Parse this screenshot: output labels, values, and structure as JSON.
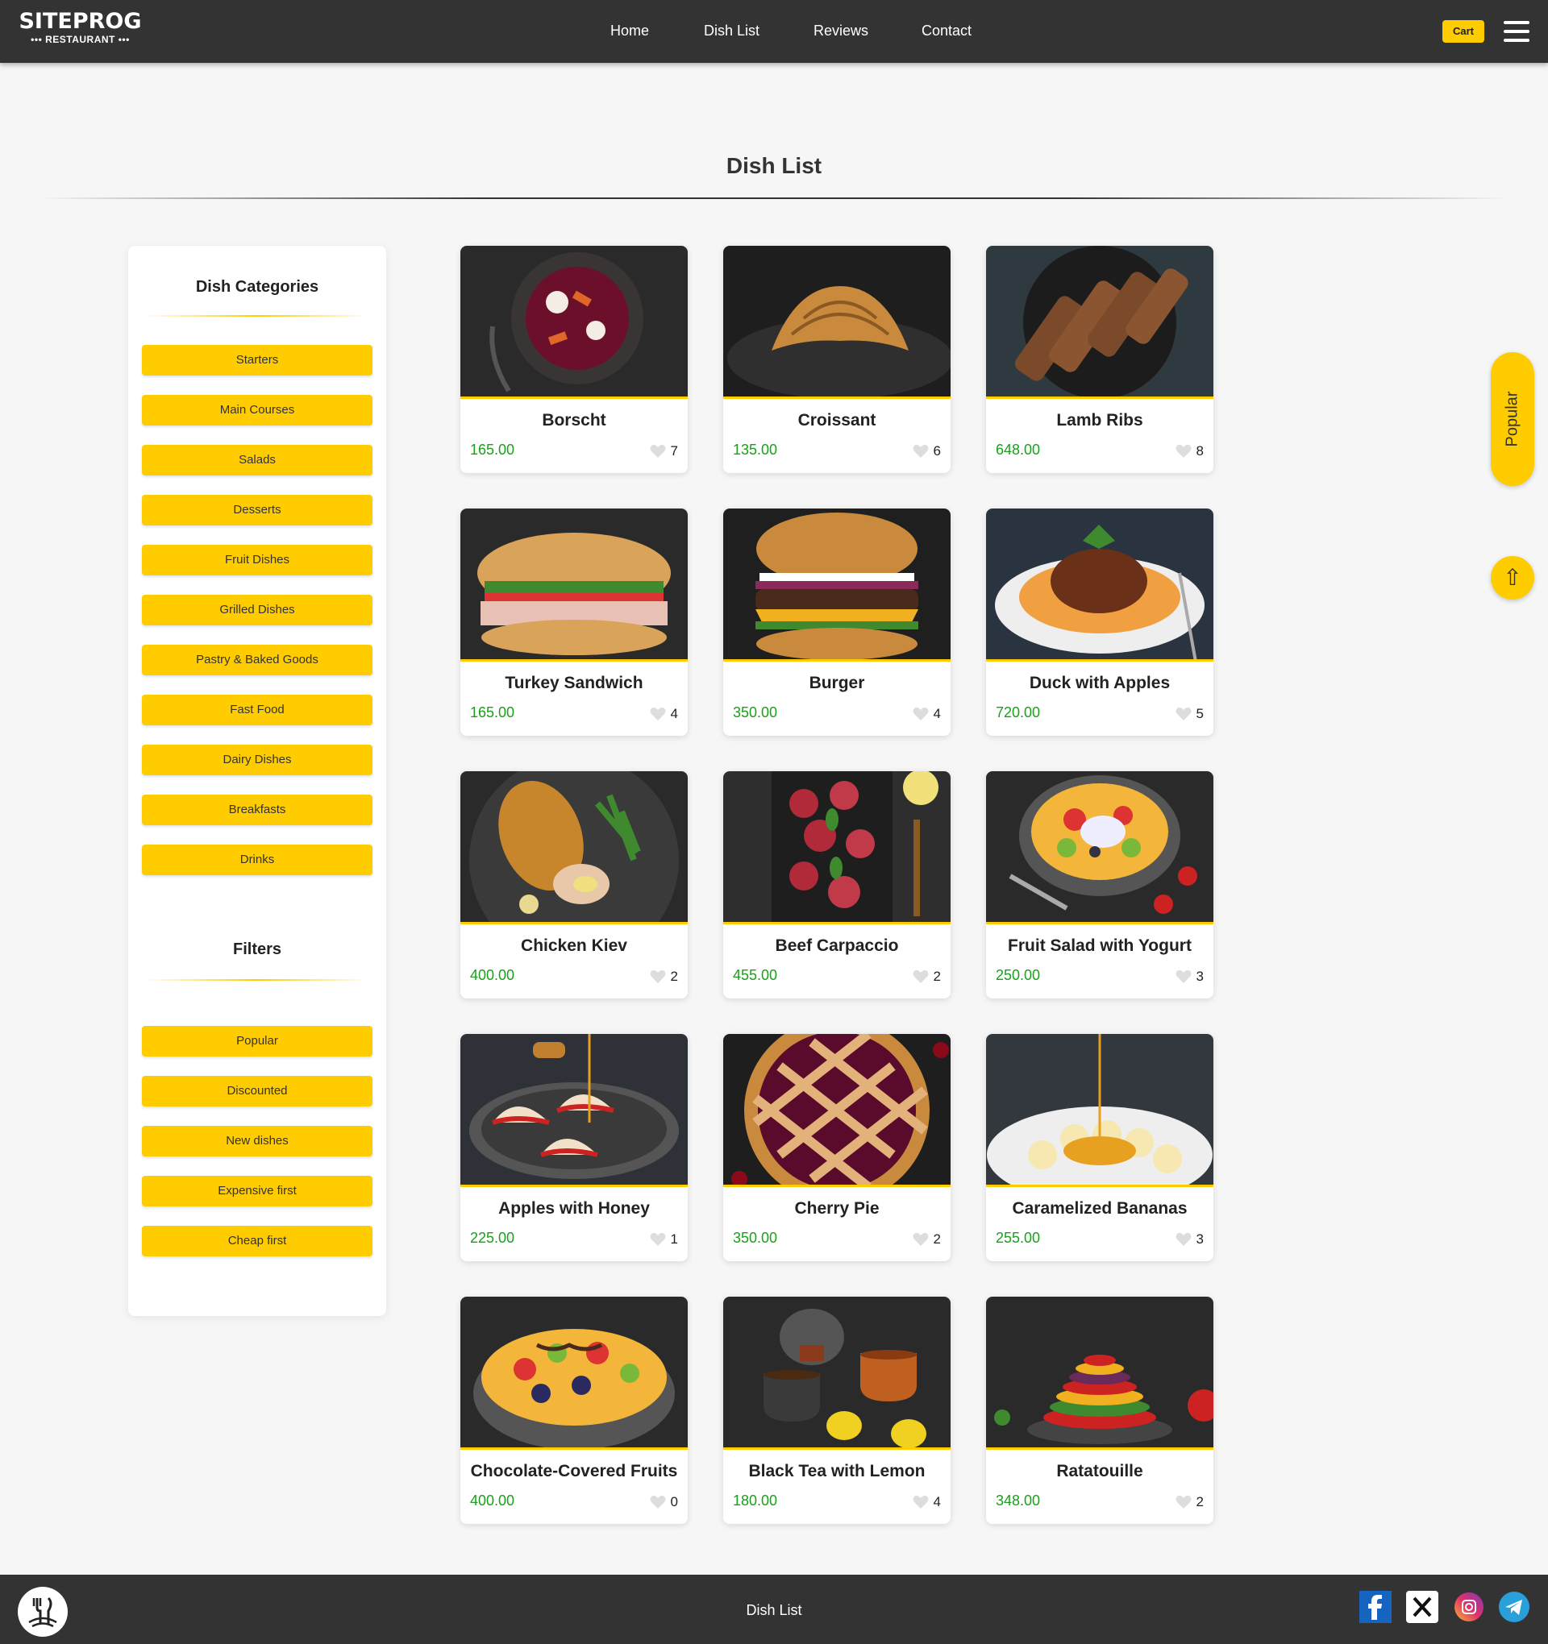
{
  "header": {
    "logo_main": "SITEPROG",
    "logo_sub": "••• RESTAURANT •••",
    "nav": [
      {
        "label": "Home"
      },
      {
        "label": "Dish List"
      },
      {
        "label": "Reviews"
      },
      {
        "label": "Contact"
      }
    ],
    "cart_label": "Cart"
  },
  "page_title": "Dish List",
  "sidebar": {
    "categories_heading": "Dish Categories",
    "categories": [
      "Starters",
      "Main Courses",
      "Salads",
      "Desserts",
      "Fruit Dishes",
      "Grilled Dishes",
      "Pastry & Baked Goods",
      "Fast Food",
      "Dairy Dishes",
      "Breakfasts",
      "Drinks"
    ],
    "filters_heading": "Filters",
    "filters": [
      "Popular",
      "Discounted",
      "New dishes",
      "Expensive first",
      "Cheap first"
    ]
  },
  "dishes": [
    {
      "name": "Borscht",
      "price": "165.00",
      "likes": "7",
      "image": "borscht-photo"
    },
    {
      "name": "Croissant",
      "price": "135.00",
      "likes": "6",
      "image": "croissant-photo"
    },
    {
      "name": "Lamb Ribs",
      "price": "648.00",
      "likes": "8",
      "image": "lamb-ribs-photo"
    },
    {
      "name": "Turkey Sandwich",
      "price": "165.00",
      "likes": "4",
      "image": "turkey-sandwich-photo"
    },
    {
      "name": "Burger",
      "price": "350.00",
      "likes": "4",
      "image": "burger-photo"
    },
    {
      "name": "Duck with Apples",
      "price": "720.00",
      "likes": "5",
      "image": "duck-photo"
    },
    {
      "name": "Chicken Kiev",
      "price": "400.00",
      "likes": "2",
      "image": "chicken-kiev-photo"
    },
    {
      "name": "Beef Carpaccio",
      "price": "455.00",
      "likes": "2",
      "image": "carpaccio-photo"
    },
    {
      "name": "Fruit Salad with Yogurt",
      "price": "250.00",
      "likes": "3",
      "image": "fruit-salad-photo"
    },
    {
      "name": "Apples with Honey",
      "price": "225.00",
      "likes": "1",
      "image": "apples-honey-photo"
    },
    {
      "name": "Cherry Pie",
      "price": "350.00",
      "likes": "2",
      "image": "cherry-pie-photo"
    },
    {
      "name": "Caramelized Bananas",
      "price": "255.00",
      "likes": "3",
      "image": "bananas-photo"
    },
    {
      "name": "Chocolate-Covered Fruits",
      "price": "400.00",
      "likes": "0",
      "image": "choco-fruits-photo"
    },
    {
      "name": "Black Tea with Lemon",
      "price": "180.00",
      "likes": "4",
      "image": "tea-photo"
    },
    {
      "name": "Ratatouille",
      "price": "348.00",
      "likes": "2",
      "image": "ratatouille-photo"
    }
  ],
  "floating": {
    "popular_label": "Popular",
    "scroll_up_icon": "arrow-up-icon"
  },
  "footer": {
    "text": "Dish List",
    "socials": [
      "facebook-icon",
      "x-icon",
      "instagram-icon",
      "telegram-icon"
    ]
  },
  "colors": {
    "accent": "#ffcc00",
    "header_bg": "#333333",
    "price": "#1aa01a"
  }
}
